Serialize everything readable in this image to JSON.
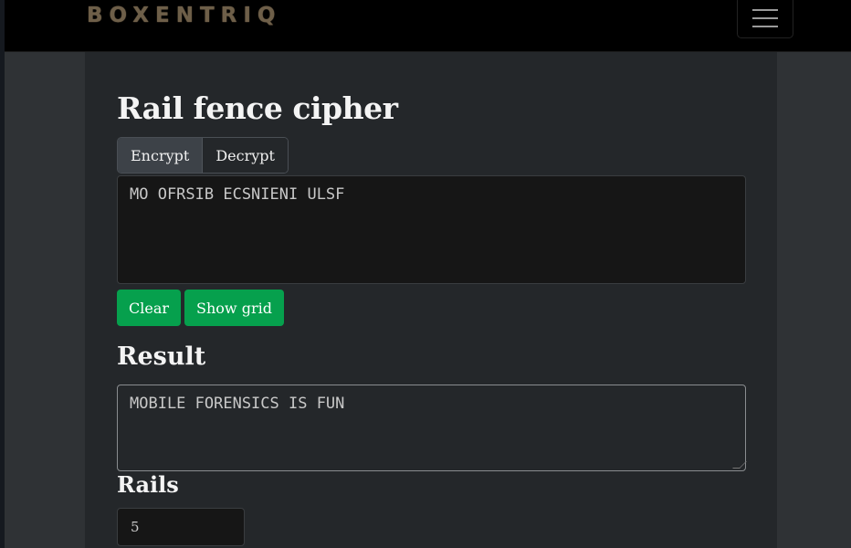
{
  "navbar": {
    "brand": "BOXENTRIQ",
    "menu_icon": "hamburger-menu-icon"
  },
  "main": {
    "title": "Rail fence cipher",
    "mode_tabs": [
      {
        "label": "Encrypt",
        "active": true
      },
      {
        "label": "Decrypt",
        "active": false
      }
    ],
    "input_text": "MO OFRSIB ECSNIENI ULSF",
    "buttons": {
      "clear": "Clear",
      "show_grid": "Show grid"
    },
    "result_heading": "Result",
    "result_text": "MOBILE FORENSICS IS FUN",
    "rails_label": "Rails",
    "rails_value": "5"
  },
  "colors": {
    "accent_green": "#06a04d",
    "brand": "#6e5f49",
    "background": "#24272a"
  }
}
